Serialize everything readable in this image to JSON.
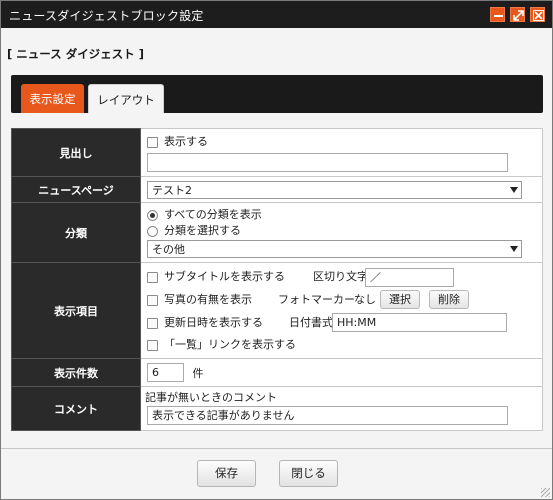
{
  "window": {
    "title": "ニュースダイジェストブロック設定"
  },
  "section": {
    "label": "[ ニュース ダイジェスト ]"
  },
  "tabs": [
    {
      "label": "表示設定",
      "active": true
    },
    {
      "label": "レイアウト",
      "active": false
    }
  ],
  "form": {
    "heading": {
      "label": "見出し",
      "show_label": "表示する",
      "show_checked": false,
      "value": ""
    },
    "news_page": {
      "label": "ニュースページ",
      "selected": "テスト2"
    },
    "category": {
      "label": "分類",
      "option_all": "すべての分類を表示",
      "option_select": "分類を選択する",
      "selected_option": "all",
      "selected_category": "その他"
    },
    "display_items": {
      "label": "表示項目",
      "subtitle_label": "サブタイトルを表示する",
      "subtitle_checked": false,
      "separator_label": "区切り文字",
      "separator_value": "／",
      "photo_label": "写真の有無を表示",
      "photo_checked": false,
      "photo_marker_label": "フォトマーカー",
      "photo_marker_value": "なし",
      "select_button": "選択",
      "delete_button": "削除",
      "updated_label": "更新日時を表示する",
      "updated_checked": false,
      "date_format_label": "日付書式",
      "date_format_value": "HH:MM",
      "list_link_label": "「一覧」リンクを表示する",
      "list_link_checked": false
    },
    "count": {
      "label": "表示件数",
      "value": "6",
      "unit": "件"
    },
    "comment": {
      "label": "コメント",
      "hint": "記事が無いときのコメント",
      "value": "表示できる記事がありません"
    }
  },
  "footer": {
    "save_label": "保存",
    "close_label": "閉じる"
  },
  "colors": {
    "accent": "#e8581c",
    "titlebar": "#1d1d1d",
    "label_cell": "#2a2a2a"
  }
}
